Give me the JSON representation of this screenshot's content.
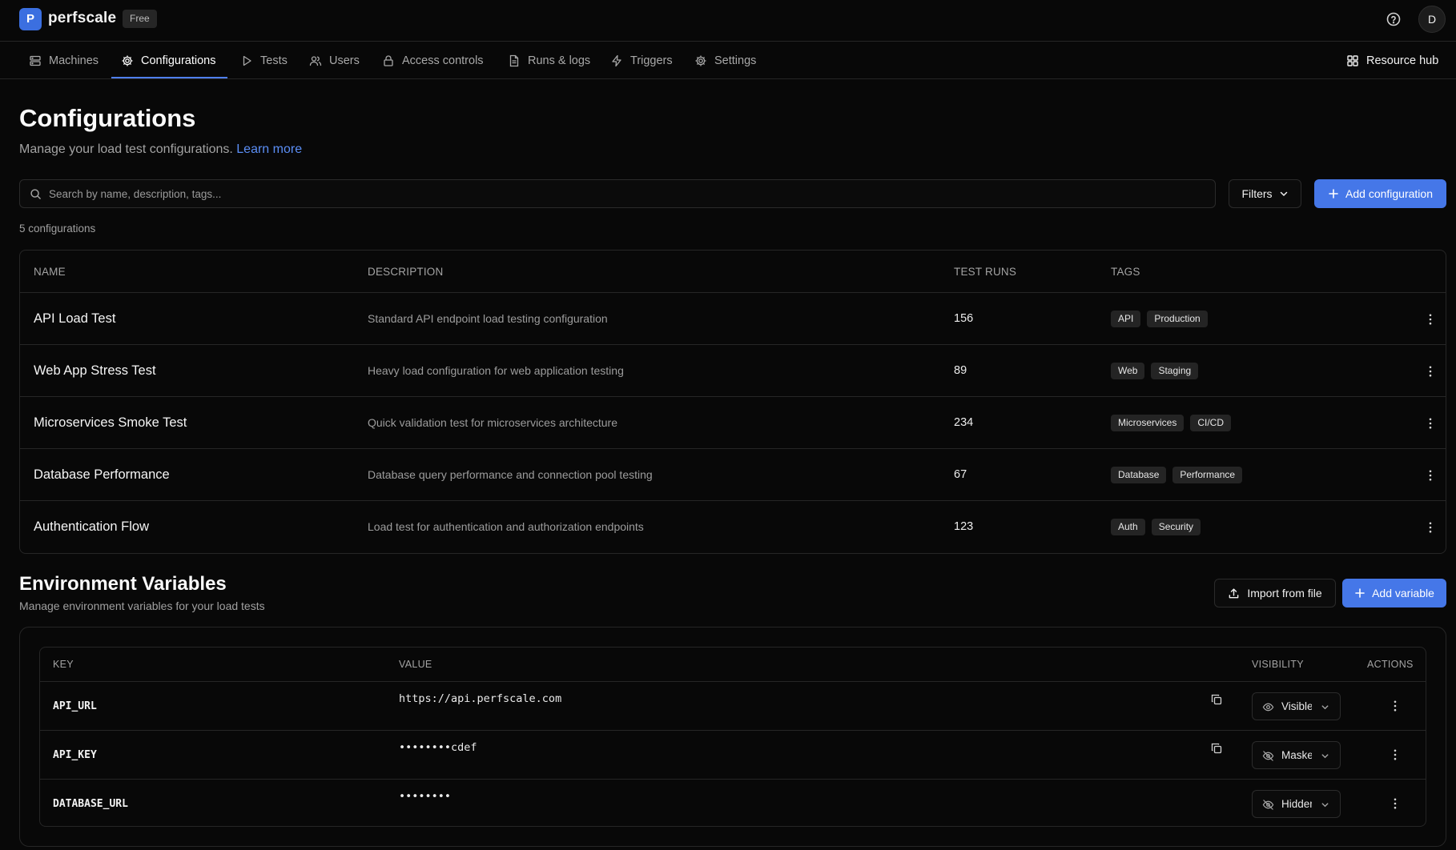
{
  "app": {
    "logo_letter": "P",
    "name": "perfscale",
    "plan": "Free",
    "user_initial": "D"
  },
  "nav": {
    "tabs": [
      {
        "label": "Machines",
        "icon": "server-icon"
      },
      {
        "label": "Configurations",
        "icon": "gear-icon",
        "active": true
      },
      {
        "label": "Tests",
        "icon": "play-icon"
      },
      {
        "label": "Users",
        "icon": "users-icon"
      },
      {
        "label": "Access controls",
        "icon": "lock-icon"
      },
      {
        "label": "Runs & logs",
        "icon": "document-icon"
      },
      {
        "label": "Triggers",
        "icon": "lightning-icon"
      },
      {
        "label": "Settings",
        "icon": "gear-icon"
      }
    ],
    "resource_hub": "Resource hub"
  },
  "page": {
    "title": "Configurations",
    "subtitle": "Manage your load test configurations.",
    "learn_more": "Learn more"
  },
  "search": {
    "placeholder": "Search by name, description, tags...",
    "value": ""
  },
  "toolbar": {
    "filters_label": "Filters",
    "add_configuration_label": "Add configuration"
  },
  "config_count": "5 configurations",
  "config_table": {
    "columns": [
      "NAME",
      "DESCRIPTION",
      "TEST RUNS",
      "TAGS"
    ],
    "rows": [
      {
        "name": "API Load Test",
        "description": "Standard API endpoint load testing configuration",
        "test_runs": "156",
        "tags": [
          "API",
          "Production"
        ]
      },
      {
        "name": "Web App Stress Test",
        "description": "Heavy load configuration for web application testing",
        "test_runs": "89",
        "tags": [
          "Web",
          "Staging"
        ]
      },
      {
        "name": "Microservices Smoke Test",
        "description": "Quick validation test for microservices architecture",
        "test_runs": "234",
        "tags": [
          "Microservices",
          "CI/CD"
        ]
      },
      {
        "name": "Database Performance",
        "description": "Database query performance and connection pool testing",
        "test_runs": "67",
        "tags": [
          "Database",
          "Performance"
        ]
      },
      {
        "name": "Authentication Flow",
        "description": "Load test for authentication and authorization endpoints",
        "test_runs": "123",
        "tags": [
          "Auth",
          "Security"
        ]
      }
    ]
  },
  "env": {
    "title": "Environment Variables",
    "subtitle": "Manage environment variables for your load tests",
    "import_label": "Import from file",
    "add_variable_label": "Add variable",
    "columns": [
      "KEY",
      "VALUE",
      "VISIBILITY",
      "ACTIONS"
    ],
    "rows": [
      {
        "key": "API_URL",
        "value": "https://api.perfscale.com",
        "visibility": "Visible",
        "copyable": true
      },
      {
        "key": "API_KEY",
        "value": "••••••••cdef",
        "visibility": "Masked",
        "copyable": true
      },
      {
        "key": "DATABASE_URL",
        "value": "••••••••",
        "visibility": "Hidden",
        "copyable": false
      }
    ]
  },
  "colors": {
    "background": "#080808",
    "accent": "#4577e8",
    "link": "#5b8ef5",
    "border": "#262626",
    "tag_bg": "#242424"
  }
}
